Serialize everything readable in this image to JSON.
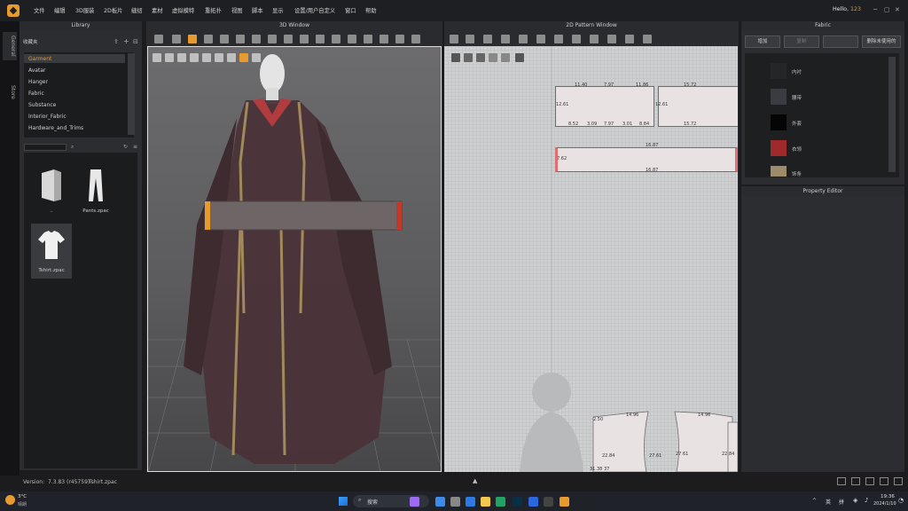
{
  "menubar": {
    "items": [
      "文件",
      "编辑",
      "3D服装",
      "2D板片",
      "缝纫",
      "素材",
      "虚拟模特",
      "重拓扑",
      "视图",
      "脚本",
      "显示",
      "设置/用户自定义",
      "窗口",
      "帮助"
    ],
    "greeting": "Hello,",
    "user": "123"
  },
  "lefttabs": [
    "General",
    "Store"
  ],
  "library": {
    "title": "Library",
    "favorites_label": "收藏夹",
    "items": [
      "Garment",
      "Avatar",
      "Hanger",
      "Fabric",
      "Substance",
      "Interior_Fabric",
      "Hardware_and_Trims"
    ],
    "files": [
      {
        "name": "..",
        "icon": "folder-back-icon"
      },
      {
        "name": "Pants.zpac",
        "icon": "pants-icon"
      },
      {
        "name": "Tshirt.zpac",
        "icon": "tshirt-icon"
      }
    ]
  },
  "window3d": {
    "title": "3D Window"
  },
  "window2d": {
    "title": "2D Pattern Window",
    "labels": {
      "a1": "11.40",
      "a2": "7.97",
      "a3": "11.86",
      "a4": "12.61",
      "a5": "8.52",
      "a6": "3.09",
      "a7": "7.97",
      "a8": "3.01",
      "a9": "8.84",
      "b1": "15.72",
      "b2": "12.61",
      "b3": "15.72",
      "c1": "16.87",
      "c2": "7.62",
      "c3": "16.87",
      "d1": "14.96",
      "d2": "14.96",
      "d3": "2.50",
      "d4": "22.84",
      "d5": "27.61",
      "d6": "27.61",
      "d7": "22.84",
      "d8": "31.38",
      "d9": "37"
    }
  },
  "fabric": {
    "title": "Fabric",
    "buttons": [
      "增加",
      "复制",
      "",
      "删除未使用的"
    ],
    "swatches": [
      {
        "label": "内衬",
        "color": "#262626"
      },
      {
        "label": "腰带",
        "color": "#3b3b42"
      },
      {
        "label": "外套",
        "color": "#050505"
      },
      {
        "label": "衣领",
        "color": "#9e2a2b"
      },
      {
        "label": "饰条",
        "color": "#9d8b6b"
      }
    ]
  },
  "property_editor": {
    "title": "Property Editor"
  },
  "statusbar": {
    "version_label": "Version:",
    "version": "7.3.83 (r45759)",
    "file": "Tshirt.zpac"
  },
  "taskbar": {
    "weather_temp": "3°C",
    "weather_desc": "晴朗",
    "search": "搜索",
    "lang": "英",
    "ime": "拼",
    "time": "19:36",
    "date": "2024/1/10"
  },
  "colors": {
    "accent": "#e79a2e",
    "robe": "#4a3338",
    "collar": "#b23b3e",
    "trim": "#a08a5a"
  }
}
